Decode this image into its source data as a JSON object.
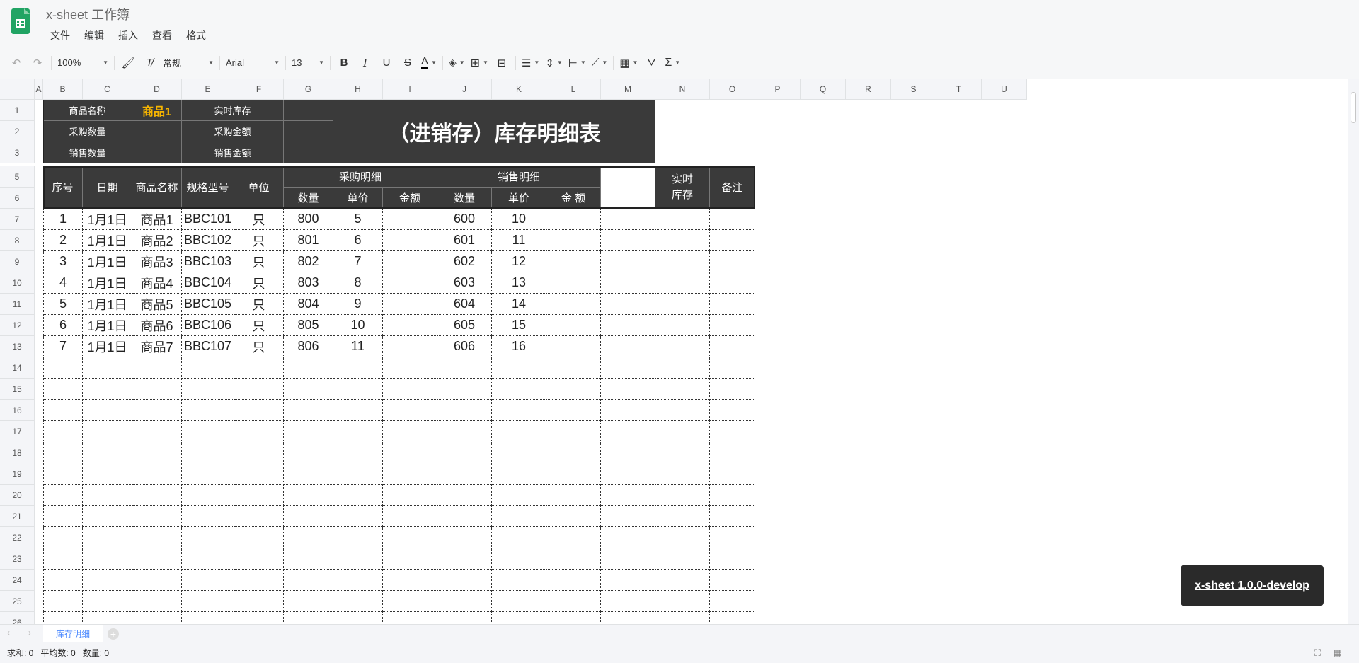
{
  "app": {
    "title": "x-sheet 工作簿",
    "menu": [
      "文件",
      "编辑",
      "插入",
      "查看",
      "格式"
    ]
  },
  "toolbar": {
    "zoom": "100%",
    "format": "常规",
    "font": "Arial",
    "font_size": "13"
  },
  "columns": [
    "A",
    "B",
    "C",
    "D",
    "E",
    "F",
    "G",
    "H",
    "I",
    "J",
    "K",
    "L",
    "M",
    "N",
    "O",
    "P",
    "Q",
    "R",
    "S",
    "T",
    "U"
  ],
  "rows": [
    "1",
    "2",
    "3",
    "5",
    "6",
    "7",
    "8",
    "9",
    "10",
    "11",
    "12",
    "13",
    "14",
    "15",
    "16",
    "17",
    "18",
    "19",
    "20",
    "21",
    "22",
    "23",
    "24",
    "25",
    "26"
  ],
  "summary": {
    "product_name_label": "商品名称",
    "product_name_value": "商品1",
    "stock_label": "实时库存",
    "purchase_qty_label": "采购数量",
    "purchase_amt_label": "采购金额",
    "sales_qty_label": "销售数量",
    "sales_amt_label": "销售金额",
    "big_title": "（进销存）库存明细表"
  },
  "table_header": {
    "seq": "序号",
    "date": "日期",
    "name": "商品名称",
    "spec": "规格型号",
    "unit": "单位",
    "purchase": "采购明细",
    "sales": "销售明细",
    "stock": "实时库存",
    "remark": "备注",
    "qty": "数量",
    "price": "单价",
    "amount": "金额",
    "amount_spaced": "金 额"
  },
  "records": [
    [
      "1",
      "1月1日",
      "商品1",
      "BBC101",
      "只",
      "800",
      "5",
      "600",
      "10"
    ],
    [
      "2",
      "1月1日",
      "商品2",
      "BBC102",
      "只",
      "801",
      "6",
      "601",
      "11"
    ],
    [
      "3",
      "1月1日",
      "商品3",
      "BBC103",
      "只",
      "802",
      "7",
      "602",
      "12"
    ],
    [
      "4",
      "1月1日",
      "商品4",
      "BBC104",
      "只",
      "803",
      "8",
      "603",
      "13"
    ],
    [
      "5",
      "1月1日",
      "商品5",
      "BBC105",
      "只",
      "804",
      "9",
      "604",
      "14"
    ],
    [
      "6",
      "1月1日",
      "商品6",
      "BBC106",
      "只",
      "805",
      "10",
      "605",
      "15"
    ],
    [
      "7",
      "1月1日",
      "商品7",
      "BBC107",
      "只",
      "806",
      "11",
      "606",
      "16"
    ]
  ],
  "sheet_tab": "库存明细",
  "status": {
    "sum": "求和: 0",
    "avg": "平均数: 0",
    "count": "数量: 0"
  },
  "version_toast": "x-sheet 1.0.0-develop"
}
